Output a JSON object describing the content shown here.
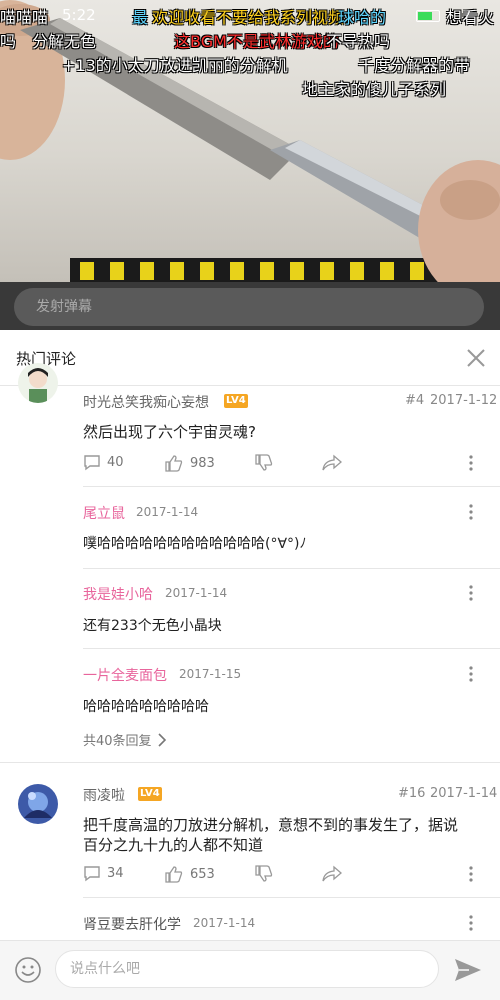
{
  "status_bar": {
    "time": "5:22"
  },
  "danmaku": [
    {
      "text": "喵喵喵",
      "color": "white"
    },
    {
      "text": "最",
      "color": "cyan"
    },
    {
      "text": "欢迎收看不要给我系列视频",
      "color": "yellow"
    },
    {
      "text": "球哈的",
      "color": "cyan"
    },
    {
      "text": "想看火",
      "color": "white"
    },
    {
      "text": "吗",
      "color": "white"
    },
    {
      "text": "分解无色",
      "color": "white"
    },
    {
      "text": "这BGM不是武林游戏的",
      "color": "red"
    },
    {
      "text": "不导热吗",
      "color": "white"
    },
    {
      "text": "+13的小太刀放进凯丽的分解机",
      "color": "white"
    },
    {
      "text": "千度分解器的带",
      "color": "white"
    },
    {
      "text": "地主家的傻儿子系列",
      "color": "white"
    }
  ],
  "danmaku_input": {
    "placeholder": "发射弹幕"
  },
  "comments_panel": {
    "title": "热门评论",
    "comments": [
      {
        "user": "时光总笑我痴心妄想",
        "level": "LV4",
        "floor": "#4",
        "date": "2017-1-12",
        "text": "然后出现了六个宇宙灵魂?",
        "reply_count": "40",
        "likes": "983",
        "replies": [
          {
            "user": "尾立鼠",
            "date": "2017-1-14",
            "text": "噗哈哈哈哈哈哈哈哈哈哈哈哈(°∀°)ﾉ"
          },
          {
            "user": "我是娃小哈",
            "date": "2017-1-14",
            "text": "还有233个无色小晶块"
          },
          {
            "user": "一片全麦面包",
            "date": "2017-1-15",
            "text": "哈哈哈哈哈哈哈哈哈"
          }
        ],
        "expand_label": "共40条回复"
      },
      {
        "user": "雨凌啦",
        "level": "LV4",
        "floor": "#16",
        "date": "2017-1-14",
        "text_line1": "把千度高温的刀放进分解机，意想不到的事发生了，据说",
        "text_line2": "百分之九十九的人都不知道",
        "reply_count": "34",
        "likes": "653",
        "replies": [
          {
            "user": "肾豆要去肝化学",
            "date": "2017-1-14"
          }
        ]
      }
    ]
  },
  "comment_input": {
    "placeholder": "说点什么吧"
  },
  "colors": {
    "accent_pink": "#e8659c",
    "level_badge": "#f5a623"
  }
}
